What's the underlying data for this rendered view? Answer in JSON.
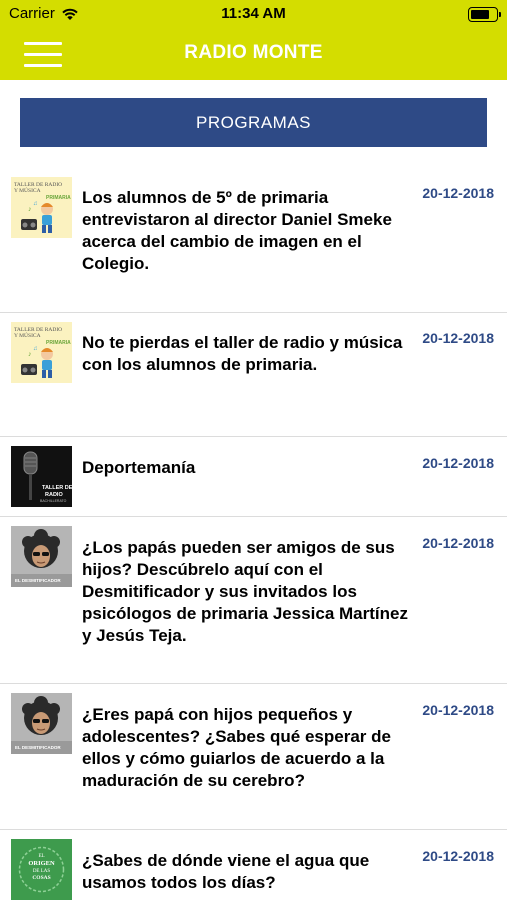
{
  "status_bar": {
    "carrier": "Carrier",
    "time": "11:34 AM",
    "battery_level": 0.8
  },
  "header": {
    "title": "RADIO MONTE",
    "menu_icon": "hamburger-menu-icon"
  },
  "section_button": {
    "label": "PROGRAMAS"
  },
  "colors": {
    "header_bg": "#d4dd00",
    "button_bg": "#2e4a86",
    "date_color": "#2e4a86"
  },
  "programs": [
    {
      "title": "Los alumnos de 5º de primaria entrevistaron al director Daniel Smeke acerca del cambio de imagen en el Colegio.",
      "date": "20-12-2018",
      "thumbnail": "taller-radio-primaria",
      "thumb_text": {
        "line1": "TALLER DE RADIO",
        "line2": "Y MÚSICA",
        "line3": "PRIMARIA"
      }
    },
    {
      "title": "No te pierdas el taller de radio y música con los alumnos de primaria.",
      "date": "20-12-2018",
      "thumbnail": "taller-radio-primaria",
      "thumb_text": {
        "line1": "TALLER DE RADIO",
        "line2": "Y MÚSICA",
        "line3": "PRIMARIA"
      }
    },
    {
      "title": "Deportemanía",
      "date": "20-12-2018",
      "thumbnail": "taller-radio-bachillerato",
      "thumb_text": {
        "line1": "TALLER DE",
        "line2": "RADIO",
        "line3": "BACHILLERATO"
      }
    },
    {
      "title": "¿Los papás pueden ser amigos de sus hijos? Descúbrelo aquí con el Desmitificador y sus invitados los psicólogos de primaria Jessica Martínez y Jesús Teja.",
      "date": "20-12-2018",
      "thumbnail": "el-desmitificador",
      "thumb_text": {
        "line1": "EL DESMITIFICADOR"
      }
    },
    {
      "title": "¿Eres papá con hijos pequeños y adolescentes? ¿Sabes qué esperar de ellos y cómo guiarlos de acuerdo a la maduración de su cerebro?",
      "date": "20-12-2018",
      "thumbnail": "el-desmitificador",
      "thumb_text": {
        "line1": "EL DESMITIFICADOR"
      }
    },
    {
      "title": "¿Sabes de dónde viene el agua que usamos todos los días?",
      "date": "20-12-2018",
      "thumbnail": "el-origen-de-las-cosas",
      "thumb_text": {
        "line1": "EL",
        "line2": "ORIGEN",
        "line3": "DE LAS",
        "line4": "COSAS"
      }
    }
  ]
}
